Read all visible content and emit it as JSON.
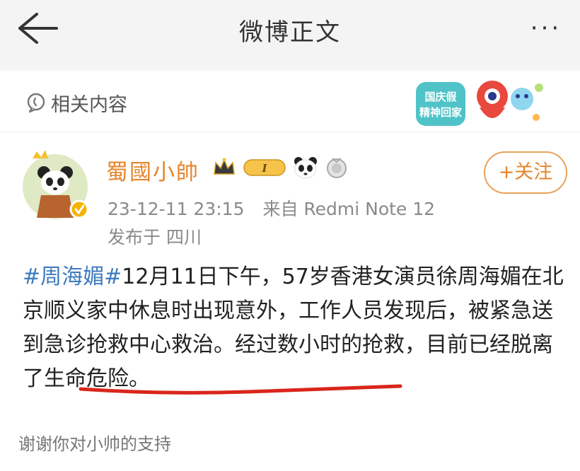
{
  "header": {
    "title": "微博正文",
    "back_icon": "back-arrow-icon",
    "more_icon": "more-dots-icon",
    "more_label": "···"
  },
  "related": {
    "label": "相关内容",
    "icon": "related-content-icon",
    "promo_text": "国庆假期精神回家"
  },
  "post": {
    "author": "蜀國小帥",
    "level_badge": "I",
    "timestamp": "23-12-11 23:15",
    "source": "来自 Redmi Note 12",
    "location": "发布于 四川",
    "follow_label": "+关注",
    "hashtag": "#周海媚#",
    "body_text": "12月11日下午，57岁香港女演员徐周海媚在北京顺义家中休息时出现意外，工作人员发现后，被紧急送到急诊抢救中心救治。经过数小时的抢救，目前已经脱离了生命危险。"
  },
  "footer": {
    "thanks": "谢谢你对小帅的支持"
  },
  "colors": {
    "author": "#e5862d",
    "hashtag": "#3d7bbd",
    "underline": "#d9261c"
  }
}
